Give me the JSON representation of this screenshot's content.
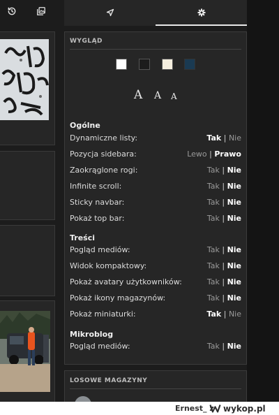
{
  "sidebar_tabs": {
    "tab_1_icon": "send-icon",
    "tab_2_icon": "gear-icon"
  },
  "left_toolbar": {
    "history_icon": "history-icon",
    "gallery_icon": "gallery-icon"
  },
  "appearance": {
    "heading": "WYGLĄD",
    "theme_colors": [
      "#ffffff",
      "#1c1c1c",
      "#f5efdf",
      "#1a3a52"
    ],
    "font_sizes": [
      "A",
      "A",
      "A"
    ]
  },
  "sections": {
    "general": {
      "title": "Ogólne",
      "rows": [
        {
          "label": "Dynamiczne listy:",
          "opt1": "Tak",
          "opt2": "Nie",
          "selected": 1
        },
        {
          "label": "Pozycja sidebara:",
          "opt1": "Lewo",
          "opt2": "Prawo",
          "selected": 2
        },
        {
          "label": "Zaokrąglone rogi:",
          "opt1": "Tak",
          "opt2": "Nie",
          "selected": 2
        },
        {
          "label": "Infinite scroll:",
          "opt1": "Tak",
          "opt2": "Nie",
          "selected": 2
        },
        {
          "label": "Sticky navbar:",
          "opt1": "Tak",
          "opt2": "Nie",
          "selected": 2
        },
        {
          "label": "Pokaż top bar:",
          "opt1": "Tak",
          "opt2": "Nie",
          "selected": 2
        }
      ]
    },
    "content": {
      "title": "Treści",
      "rows": [
        {
          "label": "Pogląd mediów:",
          "opt1": "Tak",
          "opt2": "Nie",
          "selected": 2
        },
        {
          "label": "Widok kompaktowy:",
          "opt1": "Tak",
          "opt2": "Nie",
          "selected": 2
        },
        {
          "label": "Pokaż avatary użytkowników:",
          "opt1": "Tak",
          "opt2": "Nie",
          "selected": 2
        },
        {
          "label": "Pokaż ikony magazynów:",
          "opt1": "Tak",
          "opt2": "Nie",
          "selected": 2
        },
        {
          "label": "Pokaż miniaturki:",
          "opt1": "Tak",
          "opt2": "Nie",
          "selected": 1
        }
      ]
    },
    "microblog": {
      "title": "Mikroblog",
      "rows": [
        {
          "label": "Pogląd mediów:",
          "opt1": "Tak",
          "opt2": "Nie",
          "selected": 2
        }
      ]
    }
  },
  "random_magazines": {
    "heading": "LOSOWE MAGAZYNY"
  },
  "watermark": {
    "username": "Ernest_ z",
    "brand": "wykop.pl"
  }
}
